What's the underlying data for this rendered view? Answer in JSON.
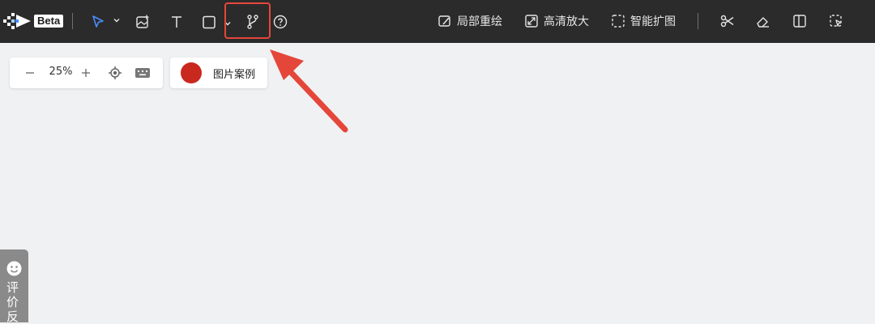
{
  "header": {
    "logo_badge": "Beta",
    "actions": {
      "inpaint": "局部重绘",
      "upscale": "高清放大",
      "outpaint": "智能扩图"
    }
  },
  "toolbar_icons": [
    "pointer-icon",
    "chevron-down-icon",
    "image-add-icon",
    "text-icon",
    "rectangle-icon",
    "branch-icon",
    "help-icon"
  ],
  "right_icons": [
    "scissors-icon",
    "eraser-icon",
    "split-view-icon",
    "select-edit-icon"
  ],
  "zoom": {
    "value": "25%"
  },
  "example": {
    "label": "图片案例",
    "color": "#c8281e"
  },
  "feedback": {
    "label": "评价反"
  },
  "colors": {
    "topbar": "#2b2b2b",
    "canvas": "#f0f1f3",
    "highlight": "#e5463a",
    "pointer_active": "#4a8cff"
  }
}
